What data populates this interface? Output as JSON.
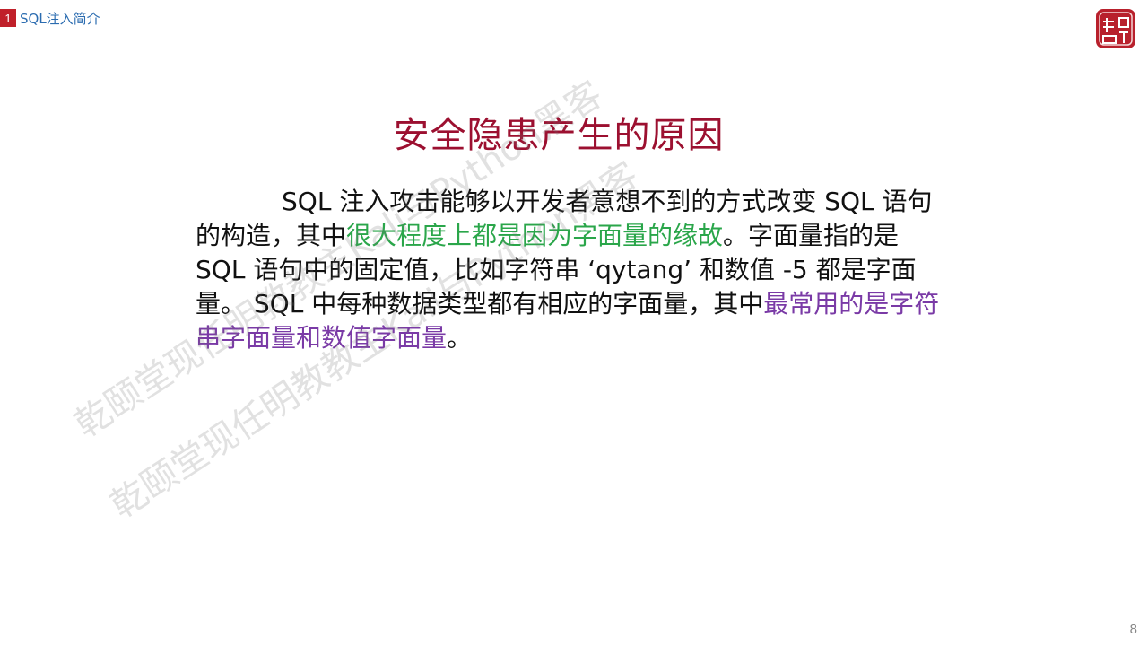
{
  "header": {
    "section_number": "1",
    "section_title": "SQL注入简介"
  },
  "logo": {
    "name": "seal-logo",
    "text": "乾颐堂"
  },
  "title": "安全隐患产生的原因",
  "paragraph": {
    "seg1": "SQL 注入攻击能够以开发者意想不到的方式改变 SQL 语句的构造，其中",
    "seg2_green": "很大程度上都是因为字面量的缘故",
    "seg3": "。字面量指的是 SQL 语句中的固定值，比如字符串 ‘qytang’ 和数值 -5 都是字面量。 SQL 中每种数据类型都有相应的字面量，其中",
    "seg4_purple": "最常用的是字符串字面量和数值字面量",
    "seg5": "。"
  },
  "page_number": "8",
  "watermark": {
    "text_1": "乾颐堂现任明教教主Kali与Python黑客",
    "text_2": "乾颐堂现任明教教主Kali与Python黑客"
  },
  "colors": {
    "title": "#9c1030",
    "highlight_green": "#2aa64a",
    "highlight_purple": "#7a3aa6",
    "section_badge": "#c0202a",
    "section_title": "#2b6cb0"
  }
}
